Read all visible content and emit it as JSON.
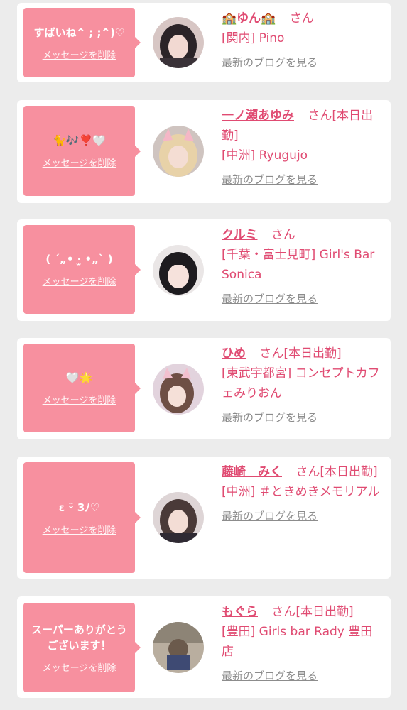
{
  "delete_label": "メッセージを削除",
  "blog_label": "最新のブログを見る",
  "colors": {
    "accent": "#e04b72",
    "bubble": "#f7909f",
    "background": "#ececec"
  },
  "cards": [
    {
      "message": "すばいね^ ; ;^)♡",
      "name": "🏫ゆん🏫",
      "san": "さん",
      "shop": "[関内] Pino"
    },
    {
      "message": "🐈🎶❣️🤍",
      "name": "一ノ瀬あゆみ",
      "san": "さん[本日出勤]",
      "shop": "[中洲] Ryugujo"
    },
    {
      "message": "( ´„• ·̫ •„` )",
      "name": "クルミ",
      "san": "さん",
      "shop": "[千葉・富士見町] Girl's Bar Sonica"
    },
    {
      "message": "🤍🌟",
      "name": "ひめ",
      "san": "さん[本日出勤]",
      "shop": "[東武宇都宮] コンセプトカフェみりおん"
    },
    {
      "message": "ɛ ᵕ̈ 3ﾉ♡",
      "name": "藤崎　みく",
      "san": "さん[本日出勤]",
      "shop": "[中洲] ＃ときめきメモリアル"
    },
    {
      "message": "スーパーありがとうございます！",
      "name": "もぐら",
      "san": "さん[本日出勤]",
      "shop": "[豊田] Girls bar Rady 豊田店"
    }
  ]
}
